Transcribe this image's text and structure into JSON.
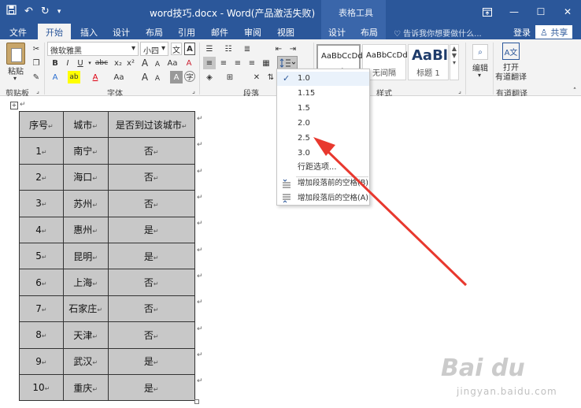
{
  "window": {
    "title": "word技巧.docx - Word(产品激活失败)",
    "context_tab_group": "表格工具",
    "controls": [
      "restore-ribbon",
      "minimize",
      "maximize",
      "close"
    ]
  },
  "quick_access": {
    "icons": [
      "save-icon",
      "undo-icon",
      "redo-icon",
      "customize-icon"
    ]
  },
  "tabs": [
    {
      "label": "文件"
    },
    {
      "label": "开始",
      "active": true
    },
    {
      "label": "插入"
    },
    {
      "label": "设计"
    },
    {
      "label": "布局"
    },
    {
      "label": "引用"
    },
    {
      "label": "邮件"
    },
    {
      "label": "审阅"
    },
    {
      "label": "视图"
    },
    {
      "label": "设计"
    },
    {
      "label": "布局"
    }
  ],
  "tell_me": "告诉我你想要做什么...",
  "login": "登录",
  "share": "共享",
  "ribbon": {
    "clipboard": {
      "paste_label": "粘贴",
      "group_label": "剪贴板"
    },
    "font": {
      "font_name": "微软雅黑",
      "font_size": "小四",
      "bold": "B",
      "italic": "I",
      "underline": "U",
      "strike": "abc",
      "subscript": "x₂",
      "superscript": "x²",
      "grow": "A",
      "shrink": "A",
      "change_case": "Aa",
      "clear": "A",
      "char_shading": "A",
      "text_effects": "A",
      "highlight": "ab",
      "font_color": "A",
      "group_label": "字体"
    },
    "paragraph": {
      "group_label": "段落"
    },
    "styles": {
      "items": [
        {
          "sample": "AaBbCcDd",
          "name": "正文"
        },
        {
          "sample": "AaBbCcDd",
          "name": "无间隔"
        },
        {
          "sample": "AaBl",
          "name": "标题 1"
        }
      ],
      "group_label": "样式"
    },
    "editing": {
      "label": "编辑"
    },
    "youdao": {
      "label_line1": "打开",
      "label_line2": "有道翻译",
      "group_label": "有道翻译"
    }
  },
  "table": {
    "headers": [
      "序号",
      "城市",
      "是否到过该城市"
    ],
    "rows": [
      [
        "1",
        "南宁",
        "否"
      ],
      [
        "2",
        "海口",
        "否"
      ],
      [
        "3",
        "苏州",
        "否"
      ],
      [
        "4",
        "惠州",
        "是"
      ],
      [
        "5",
        "昆明",
        "是"
      ],
      [
        "6",
        "上海",
        "否"
      ],
      [
        "7",
        "石家庄",
        "否"
      ],
      [
        "8",
        "天津",
        "否"
      ],
      [
        "9",
        "武汉",
        "是"
      ],
      [
        "10",
        "重庆",
        "是"
      ]
    ]
  },
  "line_spacing_menu": {
    "items": [
      "1.0",
      "1.15",
      "1.5",
      "2.0",
      "2.5",
      "3.0"
    ],
    "checked": "1.0",
    "options": "行距选项...",
    "add_before": "增加段落前的空格(B)",
    "add_after": "增加段落后的空格(A)"
  },
  "annotation": {
    "arrow_color": "#e8382e",
    "points_to": "2.5"
  },
  "watermark": {
    "logo": "Bai du",
    "sub": "jingyan.baidu.com"
  },
  "colors": {
    "ribbon_blue": "#2b579a",
    "ribbon_bg": "#f3f3f3",
    "cell_gray": "#c8c8c8"
  }
}
